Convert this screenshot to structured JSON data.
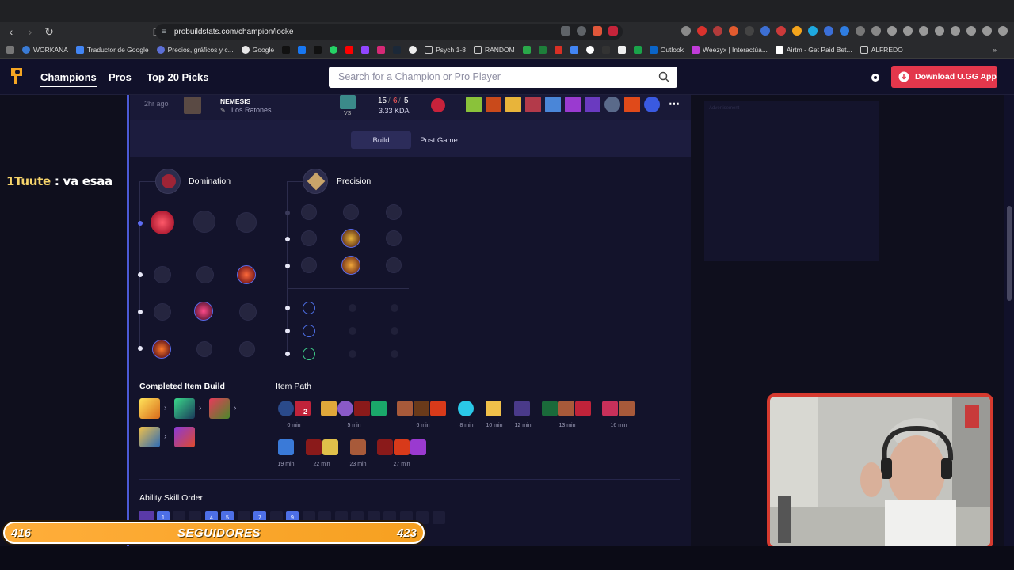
{
  "browser": {
    "url": "probuildstats.com/champion/locke",
    "bookmarks": [
      "WORKANA",
      "Traductor de Google",
      "Precios, gráficos y c...",
      "Google",
      "Psych 1-8",
      "RANDOM",
      "Outlook",
      "Weezyx | Interactúa...",
      "Airtm - Get Paid Bet...",
      "ALFREDO"
    ]
  },
  "header": {
    "nav": [
      "Champions",
      "Pros",
      "Top 20 Picks"
    ],
    "search_placeholder": "Search for a Champion or Pro Player",
    "download_label": "Download U.GG App"
  },
  "chat": {
    "user": "1Tuute",
    "separator": " : ",
    "message": "va esaa"
  },
  "match": {
    "time_ago": "2hr ago",
    "player": "NEMESIS",
    "team": "Los Ratones",
    "vs": "VS",
    "kills": "15",
    "deaths": "6",
    "assists": "5",
    "kda": "3.33 KDA",
    "more_icon": "ellipsis-icon"
  },
  "tabs": [
    "Build",
    "Post Game"
  ],
  "runes": {
    "primary_tree": "Domination",
    "secondary_tree": "Precision"
  },
  "sections": {
    "completed_build": "Completed Item Build",
    "item_path": "Item Path",
    "skill_order": "Ability Skill Order"
  },
  "item_path_times": [
    "0 min",
    "5 min",
    "6 min",
    "8 min",
    "10 min",
    "12 min",
    "13 min",
    "16 min",
    "19 min",
    "22 min",
    "23 min",
    "27 min"
  ],
  "item_stack_count": "2",
  "skill_levels": [
    "1",
    "4",
    "5",
    "7",
    "9"
  ],
  "ad_label": "Advertisement",
  "counter": {
    "left": "416",
    "label": "SEGUIDORES",
    "right": "423"
  },
  "colors": {
    "accent": "#4d6fe6",
    "download": "#e3374c",
    "counter": "#f6a020",
    "webcam_border": "#d63a2f"
  }
}
